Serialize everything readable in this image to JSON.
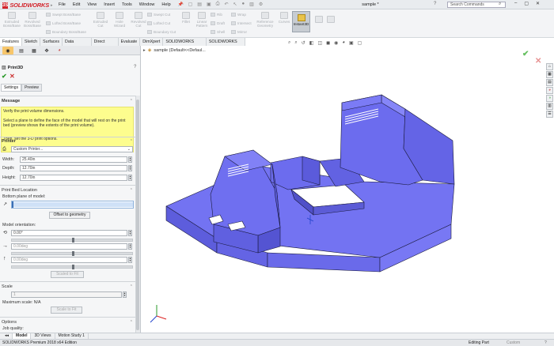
{
  "app": {
    "logo_mark": "3S",
    "logo_text": "SOLIDWORKS",
    "document_name": "sample *",
    "search_placeholder": "Search Commands",
    "menu": [
      "File",
      "Edit",
      "View",
      "Insert",
      "Tools",
      "Window",
      "Help"
    ]
  },
  "toolbar": {
    "buttons": [
      {
        "label": "Extruded\nBoss/Base"
      },
      {
        "label": "Revolved\nBoss/Base"
      },
      {
        "label": "Extruded\nCut"
      },
      {
        "label": "Hole\nWizard"
      },
      {
        "label": "Revolved\nCut"
      },
      {
        "label": "Fillet"
      },
      {
        "label": "Linear\nPattern"
      },
      {
        "label": "Reference\nGeometry"
      },
      {
        "label": "Curves"
      },
      {
        "label": "Instant3D"
      }
    ],
    "small": [
      "Swept Boss/Base",
      "Lofted Boss/Base",
      "Boundary Boss/Base",
      "Swept Cut",
      "Lofted Cut",
      "Boundary Cut",
      "Rib",
      "Wrap",
      "Draft",
      "Intersect",
      "Shell",
      "Mirror"
    ]
  },
  "command_tabs": [
    "Features",
    "Sketch",
    "Surfaces",
    "Data Migration",
    "Direct Editing",
    "Evaluate",
    "DimXpert",
    "SOLIDWORKS Add-Ins",
    "SOLIDWORKS MBD"
  ],
  "panel": {
    "title": "Print3D",
    "subtabs": [
      "Settings",
      "Preview"
    ],
    "message": {
      "header": "Message",
      "line1": "Verify the print volume dimensions.",
      "line2": "Select a  plane to define the face of the model that will rest on the print bed (preview shows the extents of the print volume).",
      "line3": "Then, set the 3-D print options."
    },
    "printer": {
      "header": "Printer",
      "select_value": "Custom Printer...",
      "width_label": "Width:",
      "width_value": "25.40in",
      "depth_label": "Depth:",
      "depth_value": "12.70in",
      "height_label": "Height:",
      "height_value": "12.70in"
    },
    "bed": {
      "header": "Print Bed Location",
      "bottom_plane_label": "Bottom plane of model:",
      "offset_button": "Offset to geometry",
      "orientation_label": "Model orientation:",
      "rot1_value": "0.00°",
      "rot2_value": "0.00deg",
      "rot3_value": "0.00deg",
      "scale_button": "Scaled to Fit"
    },
    "scale": {
      "header": "Scale",
      "value": "1",
      "max_label": "Maximum scale: N/A",
      "button": "Scale to Fit"
    },
    "options": {
      "header": "Options",
      "job_quality": "Job quality:"
    }
  },
  "viewport": {
    "breadcrumb": "sample  (Default<<Defaul..."
  },
  "bottom_tabs": [
    "Model",
    "3D Views",
    "Motion Study 1"
  ],
  "status": {
    "left": "SOLIDWORKS Premium 2018 x64 Edition",
    "mode": "Editing Part",
    "units": "Custom"
  },
  "colors": {
    "model_fill": "#6d6df0",
    "model_edge": "#1a1a3a",
    "message_bg": "#fdfd8e",
    "accent_red": "#d2232a"
  }
}
